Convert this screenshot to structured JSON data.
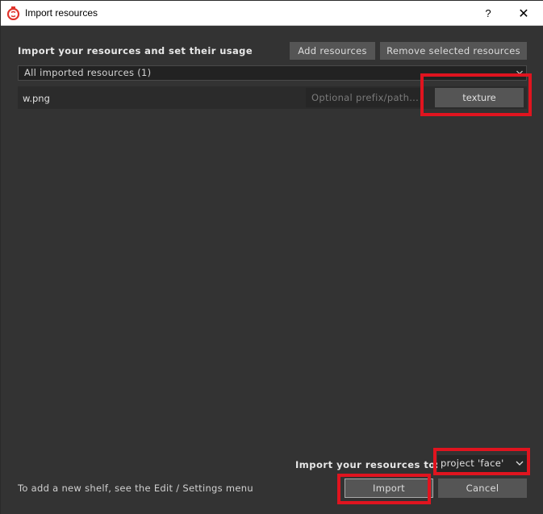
{
  "window": {
    "title": "Import resources",
    "help_label": "?",
    "close_label": "✕"
  },
  "header": {
    "heading": "Import your resources and set their usage",
    "add_label": "Add resources",
    "remove_label": "Remove selected resources"
  },
  "filter": {
    "selected": "All imported resources (1)"
  },
  "resources": [
    {
      "name": "w.png",
      "prefix_placeholder": "Optional prefix/path...",
      "usage": "texture"
    }
  ],
  "footer": {
    "import_to_label": "Import your resources to:",
    "target_selected": "project 'face'",
    "hint": "To add a new shelf, see the Edit / Settings menu",
    "import_label": "Import",
    "cancel_label": "Cancel"
  },
  "colors": {
    "accent_highlight": "#e0141f",
    "app_icon": "#e0342c",
    "background": "#333333"
  },
  "icons": {
    "app": "substance-logo-icon",
    "dropdown": "chevron-down-icon"
  }
}
